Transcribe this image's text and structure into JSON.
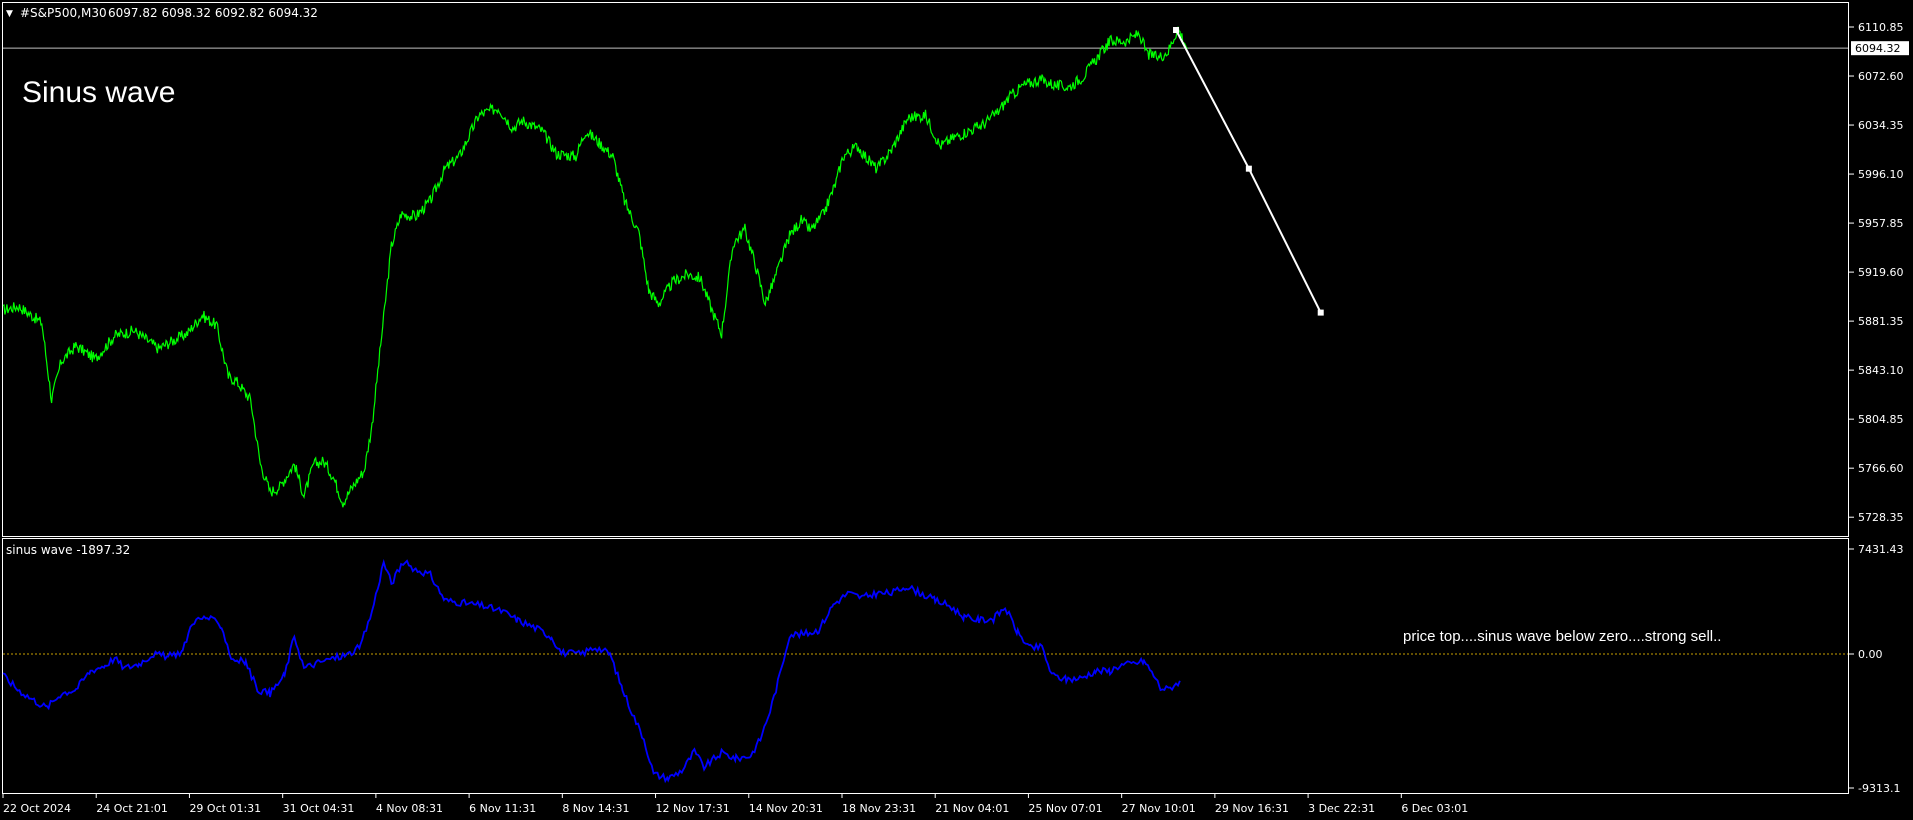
{
  "header": {
    "symbol": "#S&P500,M30",
    "ohlc": "6097.82 6098.32 6092.82 6094.32",
    "title": "Sinus wave"
  },
  "indicator": {
    "label": "sinus wave -1897.32",
    "note": "price top....sinus wave below zero....strong sell.."
  },
  "colors": {
    "price_line": "#00ff00",
    "indicator_line": "#0000ff",
    "projection_line": "#ffffff",
    "zero_line": "#c8a000",
    "frame": "#ffffff",
    "background": "#000000"
  },
  "chart_data": [
    {
      "type": "line",
      "name": "price",
      "y_tick_labels": [
        "6110.85",
        "6072.60",
        "6034.35",
        "5996.10",
        "5957.85",
        "5919.60",
        "5881.35",
        "5843.10",
        "5804.85",
        "5766.60",
        "5728.35"
      ],
      "y_ticks": [
        6110.85,
        6072.6,
        6034.35,
        5996.1,
        5957.85,
        5919.6,
        5881.35,
        5843.1,
        5804.85,
        5766.6,
        5728.35
      ],
      "current_price_label": "6094.32",
      "current_price": 6094.32,
      "ylim": [
        5718,
        6125
      ],
      "x_tick_labels": [
        "22 Oct 2024",
        "24 Oct 21:01",
        "29 Oct 01:31",
        "31 Oct 04:31",
        "4 Nov 08:31",
        "6 Nov 11:31",
        "8 Nov 14:31",
        "12 Nov 17:31",
        "14 Nov 20:31",
        "18 Nov 23:31",
        "21 Nov 04:01",
        "25 Nov 07:01",
        "27 Nov 10:01",
        "29 Nov 16:31",
        "3 Dec 22:31",
        "6 Dec 03:01"
      ],
      "x_ticks": [
        0,
        96,
        192,
        288,
        384,
        480,
        576,
        672,
        768,
        864,
        960,
        1056,
        1152,
        1248,
        1344,
        1440
      ],
      "xlim": [
        0,
        1900
      ],
      "bar_count": 1474,
      "price_keypoints": [
        [
          0,
          5890
        ],
        [
          16,
          5893
        ],
        [
          40,
          5880
        ],
        [
          50,
          5820
        ],
        [
          60,
          5850
        ],
        [
          75,
          5862
        ],
        [
          95,
          5852
        ],
        [
          115,
          5870
        ],
        [
          135,
          5874
        ],
        [
          160,
          5860
        ],
        [
          175,
          5866
        ],
        [
          190,
          5872
        ],
        [
          205,
          5886
        ],
        [
          220,
          5878
        ],
        [
          232,
          5838
        ],
        [
          240,
          5835
        ],
        [
          255,
          5820
        ],
        [
          265,
          5770
        ],
        [
          275,
          5748
        ],
        [
          285,
          5752
        ],
        [
          300,
          5770
        ],
        [
          310,
          5745
        ],
        [
          320,
          5770
        ],
        [
          330,
          5772
        ],
        [
          340,
          5760
        ],
        [
          350,
          5740
        ],
        [
          360,
          5752
        ],
        [
          372,
          5765
        ],
        [
          380,
          5800
        ],
        [
          390,
          5870
        ],
        [
          400,
          5940
        ],
        [
          410,
          5965
        ],
        [
          425,
          5963
        ],
        [
          440,
          5975
        ],
        [
          455,
          6000
        ],
        [
          470,
          6010
        ],
        [
          490,
          6042
        ],
        [
          510,
          6048
        ],
        [
          525,
          6032
        ],
        [
          535,
          6038
        ],
        [
          555,
          6030
        ],
        [
          570,
          6012
        ],
        [
          590,
          6010
        ],
        [
          600,
          6030
        ],
        [
          612,
          6022
        ],
        [
          628,
          6010
        ],
        [
          640,
          5975
        ],
        [
          655,
          5950
        ],
        [
          665,
          5905
        ],
        [
          675,
          5895
        ],
        [
          690,
          5912
        ],
        [
          705,
          5918
        ],
        [
          718,
          5915
        ],
        [
          730,
          5890
        ],
        [
          740,
          5872
        ],
        [
          752,
          5942
        ],
        [
          764,
          5953
        ],
        [
          775,
          5925
        ],
        [
          785,
          5895
        ],
        [
          795,
          5915
        ],
        [
          810,
          5948
        ],
        [
          822,
          5960
        ],
        [
          832,
          5952
        ],
        [
          845,
          5965
        ],
        [
          858,
          5990
        ],
        [
          865,
          6010
        ],
        [
          880,
          6018
        ],
        [
          890,
          6008
        ],
        [
          900,
          6000
        ],
        [
          915,
          6015
        ],
        [
          932,
          6040
        ],
        [
          950,
          6042
        ],
        [
          965,
          6018
        ],
        [
          980,
          6025
        ],
        [
          995,
          6030
        ],
        [
          1010,
          6035
        ],
        [
          1025,
          6045
        ],
        [
          1035,
          6055
        ],
        [
          1050,
          6065
        ],
        [
          1068,
          6070
        ],
        [
          1085,
          6065
        ],
        [
          1098,
          6064
        ],
        [
          1112,
          6072
        ],
        [
          1125,
          6085
        ],
        [
          1140,
          6100
        ],
        [
          1158,
          6100
        ],
        [
          1170,
          6106
        ],
        [
          1178,
          6090
        ],
        [
          1190,
          6087
        ],
        [
          1200,
          6092
        ],
        [
          1210,
          6110
        ],
        [
          1220,
          6094
        ]
      ],
      "projection": [
        {
          "x": 1208,
          "y": 6108.5
        },
        {
          "x": 1283,
          "y": 6000.3
        },
        {
          "x": 1357,
          "y": 5888.0
        }
      ]
    },
    {
      "type": "line",
      "name": "sinus wave",
      "y_tick_labels": [
        "7431.43",
        "0.00",
        "-9313.1"
      ],
      "y_ticks": [
        7431.43,
        0.0,
        -9313.1
      ],
      "current_value": -1897.32,
      "ylim": [
        -9313.1,
        7431.43
      ],
      "xlim": [
        0,
        1900
      ],
      "sinus_keypoints": [
        [
          0,
          -1500
        ],
        [
          15,
          -2500
        ],
        [
          30,
          -3200
        ],
        [
          45,
          -3800
        ],
        [
          60,
          -2800
        ],
        [
          75,
          -2500
        ],
        [
          90,
          -1200
        ],
        [
          105,
          -800
        ],
        [
          115,
          -300
        ],
        [
          125,
          -1000
        ],
        [
          140,
          -700
        ],
        [
          155,
          0
        ],
        [
          170,
          -200
        ],
        [
          185,
          200
        ],
        [
          195,
          2300
        ],
        [
          210,
          2600
        ],
        [
          225,
          2000
        ],
        [
          235,
          -300
        ],
        [
          250,
          -600
        ],
        [
          262,
          -2500
        ],
        [
          275,
          -2800
        ],
        [
          290,
          -1500
        ],
        [
          300,
          1300
        ],
        [
          310,
          -1000
        ],
        [
          325,
          -600
        ],
        [
          340,
          -300
        ],
        [
          355,
          -50
        ],
        [
          368,
          500
        ],
        [
          380,
          3000
        ],
        [
          392,
          6500
        ],
        [
          400,
          5000
        ],
        [
          412,
          6500
        ],
        [
          425,
          6000
        ],
        [
          440,
          5600
        ],
        [
          455,
          3800
        ],
        [
          475,
          3600
        ],
        [
          495,
          3400
        ],
        [
          515,
          3000
        ],
        [
          530,
          2400
        ],
        [
          550,
          1800
        ],
        [
          565,
          1200
        ],
        [
          575,
          100
        ],
        [
          595,
          0
        ],
        [
          610,
          500
        ],
        [
          625,
          0
        ],
        [
          638,
          -2500
        ],
        [
          650,
          -4500
        ],
        [
          660,
          -6000
        ],
        [
          670,
          -8500
        ],
        [
          685,
          -8800
        ],
        [
          700,
          -8200
        ],
        [
          712,
          -6900
        ],
        [
          722,
          -8000
        ],
        [
          740,
          -7000
        ],
        [
          755,
          -7400
        ],
        [
          770,
          -7200
        ],
        [
          780,
          -6000
        ],
        [
          790,
          -4000
        ],
        [
          800,
          -1500
        ],
        [
          810,
          1400
        ],
        [
          825,
          1400
        ],
        [
          840,
          1700
        ],
        [
          855,
          3500
        ],
        [
          870,
          4300
        ],
        [
          885,
          4000
        ],
        [
          900,
          4300
        ],
        [
          915,
          4300
        ],
        [
          930,
          4800
        ],
        [
          945,
          4300
        ],
        [
          960,
          3800
        ],
        [
          975,
          3400
        ],
        [
          990,
          2600
        ],
        [
          1005,
          2400
        ],
        [
          1020,
          2500
        ],
        [
          1032,
          3300
        ],
        [
          1045,
          1500
        ],
        [
          1058,
          400
        ],
        [
          1070,
          500
        ],
        [
          1080,
          -1500
        ],
        [
          1095,
          -1800
        ],
        [
          1110,
          -1700
        ],
        [
          1125,
          -1200
        ],
        [
          1140,
          -1200
        ],
        [
          1150,
          -800
        ],
        [
          1162,
          -700
        ],
        [
          1175,
          -500
        ],
        [
          1185,
          -1500
        ],
        [
          1192,
          -2400
        ],
        [
          1200,
          -2500
        ],
        [
          1212,
          -1900
        ]
      ],
      "zero_line": 0
    }
  ]
}
